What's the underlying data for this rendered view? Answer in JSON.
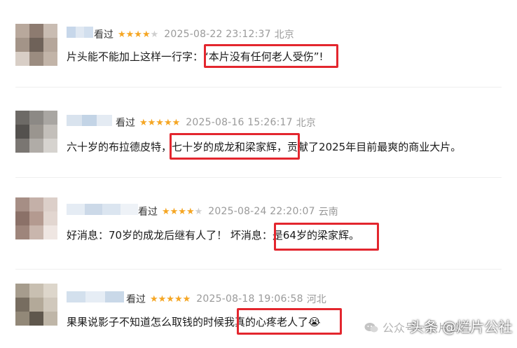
{
  "reviews": [
    {
      "status": "看过",
      "stars": "★★★★",
      "stars_off": "★",
      "time": "2025-08-22 23:12:37",
      "location": "北京",
      "comment_before": "片头能不能加上这样一行字：",
      "comment_highlight": "“本片没有任何老人受伤”!",
      "comment_after": ""
    },
    {
      "status": "看过",
      "stars": "★★★★★",
      "stars_off": "",
      "time": "2025-08-16 15:26:17",
      "location": "北京",
      "comment_before": "六十岁的布拉德皮特，",
      "comment_highlight": "七十岁的成龙和梁家辉，",
      "comment_after": "贡献了2025年目前最爽的商业大片。"
    },
    {
      "status": "看过",
      "stars": "★★★★",
      "stars_off": "★",
      "time": "2025-08-24 22:20:07",
      "location": "云南",
      "comment_before": "好消息：70岁的成龙后继有人了！ 坏消息：",
      "comment_highlight": "是64岁的梁家辉。",
      "comment_after": ""
    },
    {
      "status": "看过",
      "stars": "★★★★★",
      "stars_off": "",
      "time": "2025-08-18 19:06:58",
      "location": "河北",
      "comment_before": "果果说影子不知道怎么取钱的时候我",
      "comment_highlight": "真的心疼老人了😭",
      "comment_after": ""
    }
  ],
  "watermark": {
    "text": "公众号 · 烂片公社",
    "brand": "头条 @烂片公社"
  },
  "colors": {
    "star": "#f5a623",
    "highlight_border": "#e3262e",
    "meta_gray": "#9a9a9a"
  }
}
